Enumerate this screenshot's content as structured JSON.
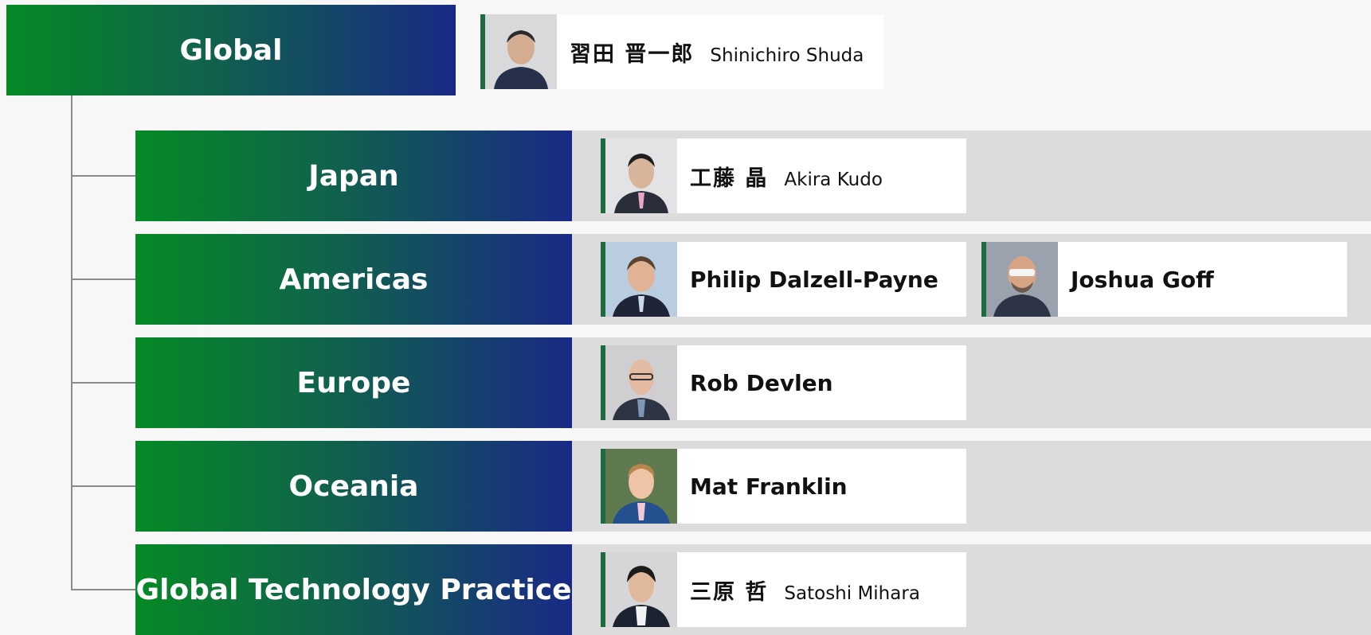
{
  "global": {
    "label": "Global",
    "leader": {
      "name_ja": "習田 晋一郎",
      "name_en": "Shinichiro Shuda",
      "photo": "person-photo"
    }
  },
  "regions": [
    {
      "label": "Japan",
      "leaders": [
        {
          "name_ja": "工藤 晶",
          "name_en": "Akira Kudo"
        }
      ]
    },
    {
      "label": "Americas",
      "leaders": [
        {
          "name_en": "Philip Dalzell-Payne"
        },
        {
          "name_en": "Joshua Goff"
        }
      ]
    },
    {
      "label": "Europe",
      "leaders": [
        {
          "name_en": "Rob Devlen"
        }
      ]
    },
    {
      "label": "Oceania",
      "leaders": [
        {
          "name_en": "Mat Franklin"
        }
      ]
    },
    {
      "label": "Global Technology Practice",
      "leaders": [
        {
          "name_ja": "三原 哲",
          "name_en": "Satoshi Mihara"
        }
      ]
    }
  ],
  "colors": {
    "gradient_start": "#058a25",
    "gradient_end": "#192a85",
    "band": "#dcdcdc",
    "card_accent": "#1d6b3e",
    "connector": "#8a8a8a"
  }
}
